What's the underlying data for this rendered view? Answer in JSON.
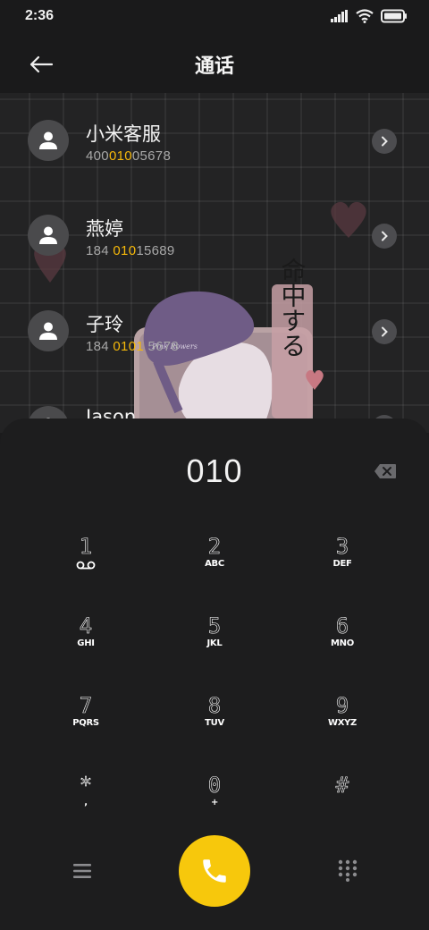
{
  "status_bar": {
    "time": "2:36",
    "icons": [
      "signal-icon",
      "wifi-icon",
      "battery-icon"
    ]
  },
  "header": {
    "title": "通话",
    "back_icon": "arrow-left-icon"
  },
  "contacts": [
    {
      "name": "小米客服",
      "number_pre": "400",
      "number_hl": "010",
      "number_post": "05678"
    },
    {
      "name": "燕婷",
      "number_pre": "184 ",
      "number_hl": "010",
      "number_post": "15689"
    },
    {
      "name": "子玲",
      "number_pre": "184 ",
      "number_hl": "0101",
      "number_post": " 5678"
    },
    {
      "name": "Jason",
      "number_pre": "",
      "number_hl": "",
      "number_post": ""
    }
  ],
  "wallpaper": {
    "stamp_text": "命中する"
  },
  "dialer": {
    "input_value": "010",
    "keys": [
      {
        "digit": "1",
        "letters": "QO"
      },
      {
        "digit": "2",
        "letters": "ABC"
      },
      {
        "digit": "3",
        "letters": "DEF"
      },
      {
        "digit": "4",
        "letters": "GHI"
      },
      {
        "digit": "5",
        "letters": "JKL"
      },
      {
        "digit": "6",
        "letters": "MNO"
      },
      {
        "digit": "7",
        "letters": "PQRS"
      },
      {
        "digit": "8",
        "letters": "TUV"
      },
      {
        "digit": "9",
        "letters": "WXYZ"
      },
      {
        "digit": "*",
        "letters": ","
      },
      {
        "digit": "0",
        "letters": "+"
      },
      {
        "digit": "#",
        "letters": ""
      }
    ]
  },
  "colors": {
    "accent": "#f7c80c",
    "highlight": "#f5b80a",
    "background": "#1d1d1e"
  }
}
